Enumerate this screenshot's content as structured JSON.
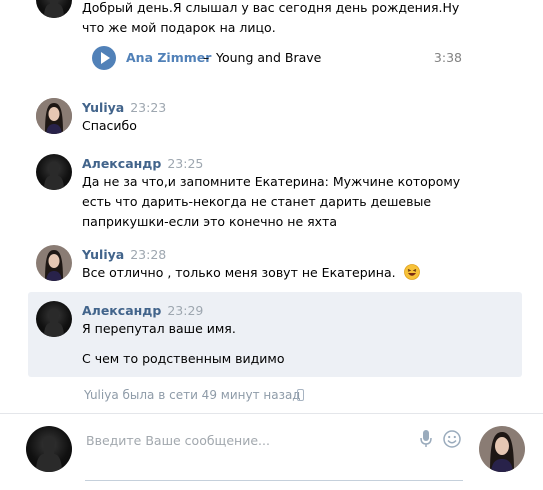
{
  "messages": [
    {
      "text": "Добрый день.Я слышал у вас сегодня день рождения.Ну что же мой подарок на лицо."
    },
    {
      "author": "Yuliya",
      "time": "23:23",
      "text": "Спасибо"
    },
    {
      "author": "Александр",
      "time": "23:25",
      "text": "Да не за что,и запомните Екатерина: Мужчине которому есть что дарить-некогда не станет дарить дешевые паприкушки-если это конечно не яхта"
    },
    {
      "author": "Yuliya",
      "time": "23:28",
      "text": "Все отлично , только меня зовут не Екатерина."
    },
    {
      "author": "Александр",
      "time": "23:29",
      "text": "Я перепутал ваше имя.",
      "text2": "С чем то родственным видимо"
    }
  ],
  "audio": {
    "artist": "Ana Zimmer",
    "dash": "–",
    "title": "Young and Brave",
    "duration": "3:38"
  },
  "status": "Yuliya была в сети 49 минут назад",
  "composer": {
    "placeholder": "Введите Ваше сообщение..."
  },
  "colors": {
    "author": "#42648b",
    "accent": "#5181b8",
    "highlight": "#edf0f5",
    "time": "#9ea7b0"
  },
  "icons": [
    "play-icon",
    "phone-icon",
    "mic-icon",
    "smile-icon",
    "laughing-emoji-icon"
  ]
}
